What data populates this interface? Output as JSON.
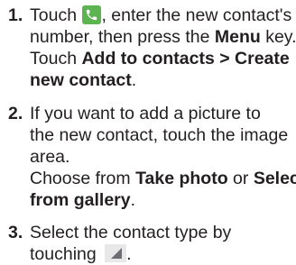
{
  "steps": [
    {
      "number": "1.",
      "line1_before": "Touch ",
      "line1_after": ", enter the new contact's",
      "line2_before": "number, then press the ",
      "line2_bold": "Menu",
      "line2_after": " key.",
      "line3_before": "Touch ",
      "line3_bold1": "Add to contacts",
      "line3_mid": " > ",
      "line3_bold2": "Create",
      "line4_bold": "new contact",
      "line4_after": ".",
      "icon": "phone-icon"
    },
    {
      "number": "2.",
      "line1": "If you want to add a picture to",
      "line2": "the new contact, touch the image",
      "line3": "area.",
      "line4_before": "Choose from ",
      "line4_bold1": "Take photo",
      "line4_mid": " or ",
      "line4_bold2": "Select",
      "line5_bold": "from gallery",
      "line5_after": "."
    },
    {
      "number": "3.",
      "line1": "Select the contact type by",
      "line2_before": "touching ",
      "line2_after": ".",
      "icon": "triangle-icon"
    }
  ],
  "colors": {
    "text": "#231f20",
    "phone_icon_bg": "#5bb44f",
    "triangle_icon_bg": "#e8e8e8"
  }
}
